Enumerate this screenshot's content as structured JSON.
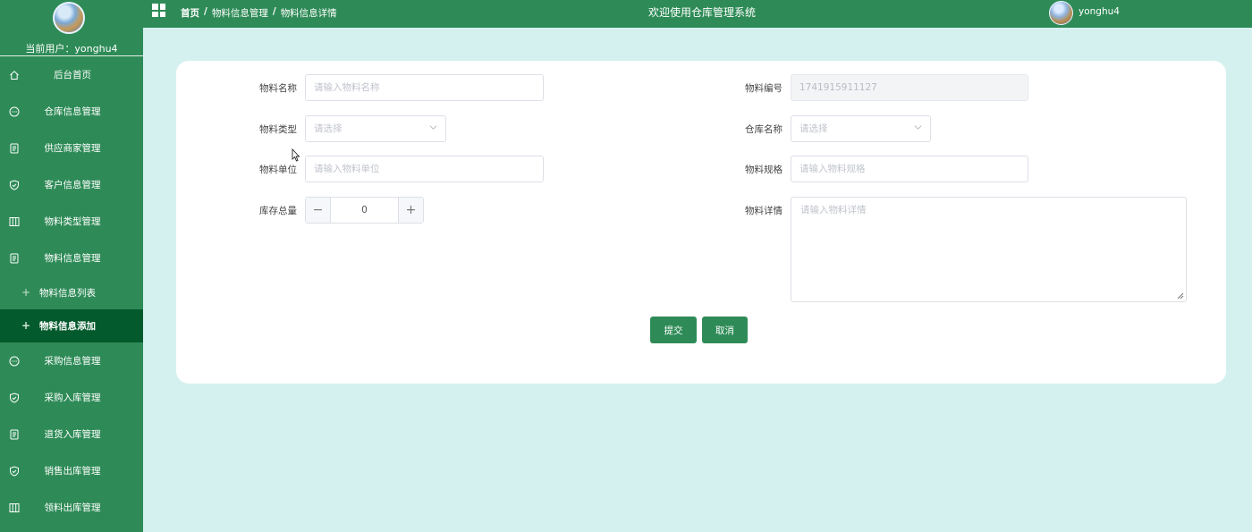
{
  "sidebar": {
    "current_user_label": "当前用户：",
    "current_user": "yonghu4",
    "items": [
      {
        "label": "后台首页",
        "icon": "home-icon"
      },
      {
        "label": "仓库信息管理",
        "icon": "chat-icon"
      },
      {
        "label": "供应商家管理",
        "icon": "document-icon"
      },
      {
        "label": "客户信息管理",
        "icon": "shield-check-icon"
      },
      {
        "label": "物料类型管理",
        "icon": "columns-icon"
      },
      {
        "label": "物料信息管理",
        "icon": "document-icon"
      }
    ],
    "sub_items": [
      {
        "label": "物料信息列表"
      },
      {
        "label": "物料信息添加",
        "active": true
      }
    ],
    "items_after": [
      {
        "label": "采购信息管理",
        "icon": "chat-icon"
      },
      {
        "label": "采购入库管理",
        "icon": "shield-check-icon"
      },
      {
        "label": "退货入库管理",
        "icon": "document-icon"
      },
      {
        "label": "销售出库管理",
        "icon": "shield-check-icon"
      },
      {
        "label": "领料出库管理",
        "icon": "columns-icon"
      }
    ]
  },
  "topbar": {
    "breadcrumb": [
      "首页",
      "物料信息管理",
      "物料信息详情"
    ],
    "separator": "/",
    "welcome": "欢迎使用仓库管理系统",
    "username": "yonghu4"
  },
  "form": {
    "name": {
      "label": "物料名称",
      "placeholder": "请输入物料名称"
    },
    "code": {
      "label": "物料编号",
      "value": "1741915911127"
    },
    "type": {
      "label": "物料类型",
      "placeholder": "请选择"
    },
    "warehouse": {
      "label": "仓库名称",
      "placeholder": "请选择"
    },
    "unit": {
      "label": "物料单位",
      "placeholder": "请输入物料单位"
    },
    "spec": {
      "label": "物料规格",
      "placeholder": "请输入物料规格"
    },
    "stock": {
      "label": "库存总量",
      "value": "0",
      "minus": "−",
      "plus": "+"
    },
    "detail": {
      "label": "物料详情",
      "placeholder": "请输入物料详情"
    },
    "submit_label": "提交",
    "cancel_label": "取消"
  },
  "colors": {
    "primary": "#2e8b57",
    "active": "#035a2c",
    "background": "#d4f1ef"
  }
}
